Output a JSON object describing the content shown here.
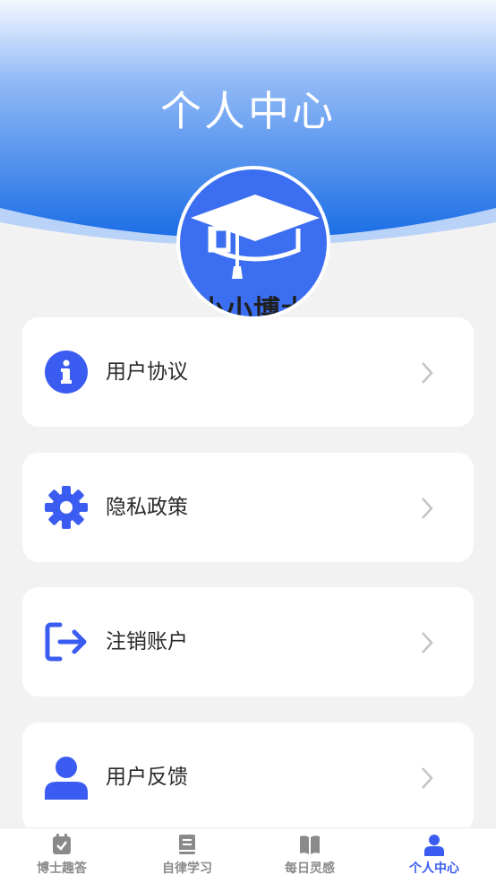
{
  "header": {
    "title": "个人中心"
  },
  "profile": {
    "name": "小小博士"
  },
  "menu": {
    "items": [
      {
        "label": "用户协议",
        "icon": "info-icon"
      },
      {
        "label": "隐私政策",
        "icon": "gear-icon"
      },
      {
        "label": "注销账户",
        "icon": "logout-icon"
      },
      {
        "label": "用户反馈",
        "icon": "user-icon"
      }
    ]
  },
  "tabbar": {
    "tabs": [
      {
        "label": "博士趣答",
        "icon": "calendar-check-icon"
      },
      {
        "label": "自律学习",
        "icon": "book-icon"
      },
      {
        "label": "每日灵感",
        "icon": "open-book-icon"
      },
      {
        "label": "个人中心",
        "icon": "person-icon",
        "active": true
      }
    ]
  },
  "colors": {
    "accent": "#3b5cf0",
    "header_top": "#eef4ff",
    "header_bottom": "#1c6fe8",
    "background": "#f2f2f2",
    "tab_inactive": "#8a8a8a"
  }
}
